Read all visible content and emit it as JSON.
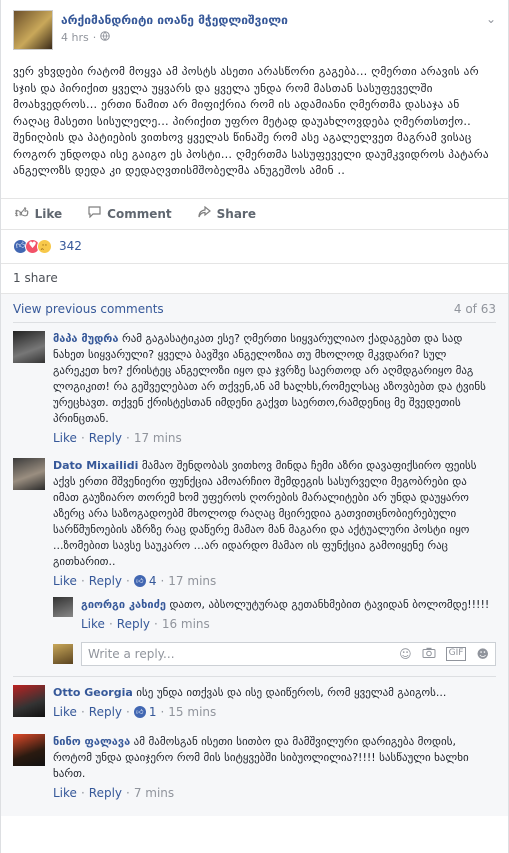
{
  "post": {
    "author": "არქიმანდრიტი იოანე მჭედლიშვილი",
    "time": "4 hrs",
    "privacy_icon": "globe-icon",
    "paragraph1": "ვერ ვხვდები რატომ მოყვა ამ პოსტს ასეთი არასწორი გაგება... ღმერთი არავის არ სჯის და პირიქით ყველა უყვარს და ყველა უნდა რომ მასთან სასუფეველში მოახვედროს... ერთი წამით არ მიფიქრია რომ ის ადამიანი ღმერთმა დასაჯა ან რაღაც მასეთი სისულელე... პირიქით უფრო მეტად დაუახლოვდება ღმერთსთქო..",
    "paragraph2": "შენიღბის და პატიების ვითხოვ ყველას წინაშე რომ ასე აგალელვეთ მაგრამ ვისაც როგორ უნდოდა ისე გაიგო ეს პოსტი... ღმერთმა სასუფეველი დაუმკვიდროს პატარა ანგელოზს დედა კი დედაღვთისმშობელმა ანუგეშოს ამინ .."
  },
  "actions": {
    "like": "Like",
    "comment": "Comment",
    "share": "Share"
  },
  "reactions": {
    "count": "342"
  },
  "shares": "1 share",
  "comments_header": {
    "view_previous": "View previous comments",
    "counter": "4 of 63"
  },
  "comments": [
    {
      "name": "მაპა მუდრა",
      "text": "რამ გაგასატიკათ ესე? ღმერთი სიყვარულიაო ქადაგებთ და სად ნახეთ სიყვარული? ყველა ბავშვი ანგელოზია თუ მხოლოდ მკვდარი? სულ გარეკეთ ხო? ქრისტეც ანგელოზი იყო და ჯვრზე საერთოდ არ აღმდგარიყო მაგ ლოგიკით! რა გეშველებათ არ თქვენ,ან ამ ხალხს,რომელსაც აზოვბებთ და ტვინს ურეცხავთ. თქვენ ქრისტესთან იმდენი გაქვთ საერთო,რამდენიც მე შვედეთის პრინცთან.",
      "like": "Like",
      "reply": "Reply",
      "time": "17 mins"
    },
    {
      "name": "Dato Mixailidi",
      "text": "მამაო შენდობას ვითხოვ მინდა ჩემი აზრი დავაფიქსირო ფეისს აქვს ერთი მშვენიერი ფუნქცია ამოარჩიო შემდეგის სასურველი მეგობრები და იმათ გაუზიარო თორემ ხომ უფეროს ღორების მარალიტები არ უნდა დაუყარო აზერც არა საზოგადოებმ მხოლოდ რაღაც მცირედია გათვითცნობიერებული სარწმუნოების აზრზე რაც დაწერე მამაო მან მაგარი და აქტუალური პოსტი იყო ...ზომებით სავსე საუკარო ...არ იდარდო მამაო ის ფუნქცია გამოიყენე რაც გითხარით..",
      "like": "Like",
      "reply": "Reply",
      "likes": "4",
      "time": "17 mins"
    }
  ],
  "nested_reply": {
    "name": "გიორგი კახიძე",
    "text": "დათო, აბსოლუტურად გეთანხმებით ტავიდან ბოლომდე!!!!!",
    "like": "Like",
    "reply": "Reply",
    "time": "16 mins"
  },
  "reply_box": {
    "placeholder": "Write a reply..."
  },
  "comments2": [
    {
      "name": "Otto Georgia",
      "text": "ისე უნდა ითქვას და ისე დაიწეროს, რომ ყველამ გაიგოს...",
      "like": "Like",
      "reply": "Reply",
      "likes": "1",
      "time": "15 mins"
    },
    {
      "name": "ნინო ფალავა",
      "text": "ამ მამოსგან ისეთი სითბო და მამშვილური დარიგება მოდის, როტომ უნდა დაიჯერო რომ მის სიტყვებში სიბუოლილია?!!!! სასწაული ხალხი ხართ.",
      "like": "Like",
      "reply": "Reply",
      "time": "7 mins"
    }
  ]
}
